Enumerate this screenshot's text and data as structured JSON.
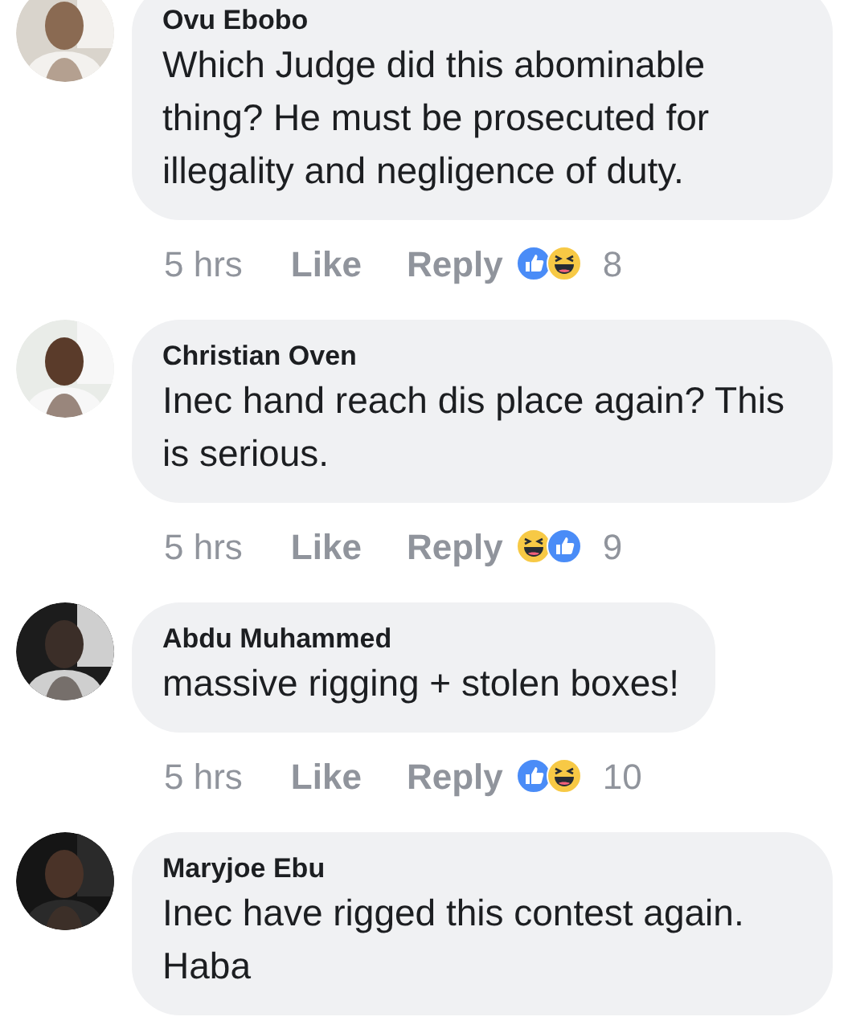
{
  "comments": [
    {
      "author": "Ovu Ebobo",
      "text": "Which Judge did this abominable thing? He must be prosecuted for illegality and negligence of duty.",
      "time": "5 hrs",
      "like_label": "Like",
      "reply_label": "Reply",
      "reactions": [
        {
          "kind": "like"
        },
        {
          "kind": "haha"
        }
      ],
      "reaction_count": "8"
    },
    {
      "author": "Christian Oven",
      "text": "Inec hand reach dis place again? This is serious.",
      "time": "5 hrs",
      "like_label": "Like",
      "reply_label": "Reply",
      "reactions": [
        {
          "kind": "haha"
        },
        {
          "kind": "like"
        }
      ],
      "reaction_count": "9"
    },
    {
      "author": "Abdu Muhammed",
      "text": "massive rigging + stolen boxes!",
      "time": "5 hrs",
      "like_label": "Like",
      "reply_label": "Reply",
      "reactions": [
        {
          "kind": "like"
        },
        {
          "kind": "haha"
        }
      ],
      "reaction_count": "10"
    },
    {
      "author": "Maryjoe Ebu",
      "text": "Inec have rigged this contest again. Haba"
    }
  ]
}
